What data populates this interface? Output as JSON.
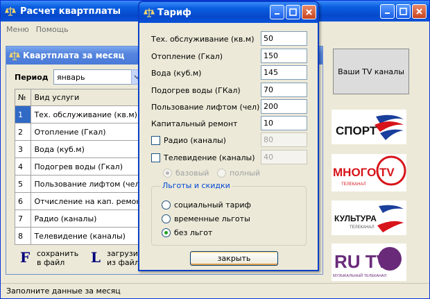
{
  "main_window": {
    "title": "Расчет квартплаты",
    "menu": [
      "Меню",
      "Помощь"
    ],
    "status": "Заполните данные за месяц"
  },
  "child_window": {
    "title": "Квартплата за месяц",
    "period_label": "Период",
    "period_value": "январь",
    "table": {
      "headers": [
        "№",
        "Вид услуги"
      ],
      "rows": [
        [
          "1",
          "Тех. обслуживание (кв.м)"
        ],
        [
          "2",
          "Отопление (Гкал)"
        ],
        [
          "3",
          "Вода (куб.м)"
        ],
        [
          "4",
          "Подогрев воды (Гкал)"
        ],
        [
          "5",
          "Пользование лифтом (чел)"
        ],
        [
          "6",
          "Отчисление на кап. ремонт"
        ],
        [
          "7",
          "Радио (каналы)"
        ],
        [
          "8",
          "Телевидение (каналы)"
        ]
      ]
    },
    "save_key": "F",
    "save_text": "сохранить\nв файл",
    "load_key": "L",
    "load_text": "загрузить\nиз файла",
    "tv_button": "Ваши TV  каналы",
    "channels": [
      "СПОРТ",
      "МНОГО TV",
      "КУЛЬТУРА",
      "RU TV"
    ],
    "channel_sublabels": {
      "mnogo": "ТЕЛЕКАНАЛ",
      "kultura": "ТЕЛЕКАНАЛ",
      "rutv": "МУЗЫКАЛЬНЫЙ ТЕЛЕКАНАЛ"
    }
  },
  "dialog": {
    "title": "Тариф",
    "fields": [
      {
        "label": "Тех. обслуживание (кв.м)",
        "value": "50"
      },
      {
        "label": "Отопление (Гкал)",
        "value": "150"
      },
      {
        "label": "Вода (куб.м)",
        "value": "145"
      },
      {
        "label": "Подогрев воды (ГКал)",
        "value": "70"
      },
      {
        "label": "Пользование лифтом (чел)",
        "value": "200"
      },
      {
        "label": "Капитальный ремонт",
        "value": "10"
      }
    ],
    "radio_check": {
      "label": "Радио (каналы)",
      "value": "80"
    },
    "tv_check": {
      "label": "Телевидение (каналы)",
      "value": "40"
    },
    "package_basic": "базовый",
    "package_full": "полный",
    "discounts_title": "Льготы и скидки",
    "discounts": [
      "социальный тариф",
      "временные льготы",
      "без льгот"
    ],
    "close_label": "закрыть"
  },
  "colors": {
    "title_bar": "#0a53d8",
    "selection": "#316ac5",
    "group_title": "#0046d5",
    "sport_red": "#d7141a",
    "rutv_purple": "#6a2a7a"
  }
}
